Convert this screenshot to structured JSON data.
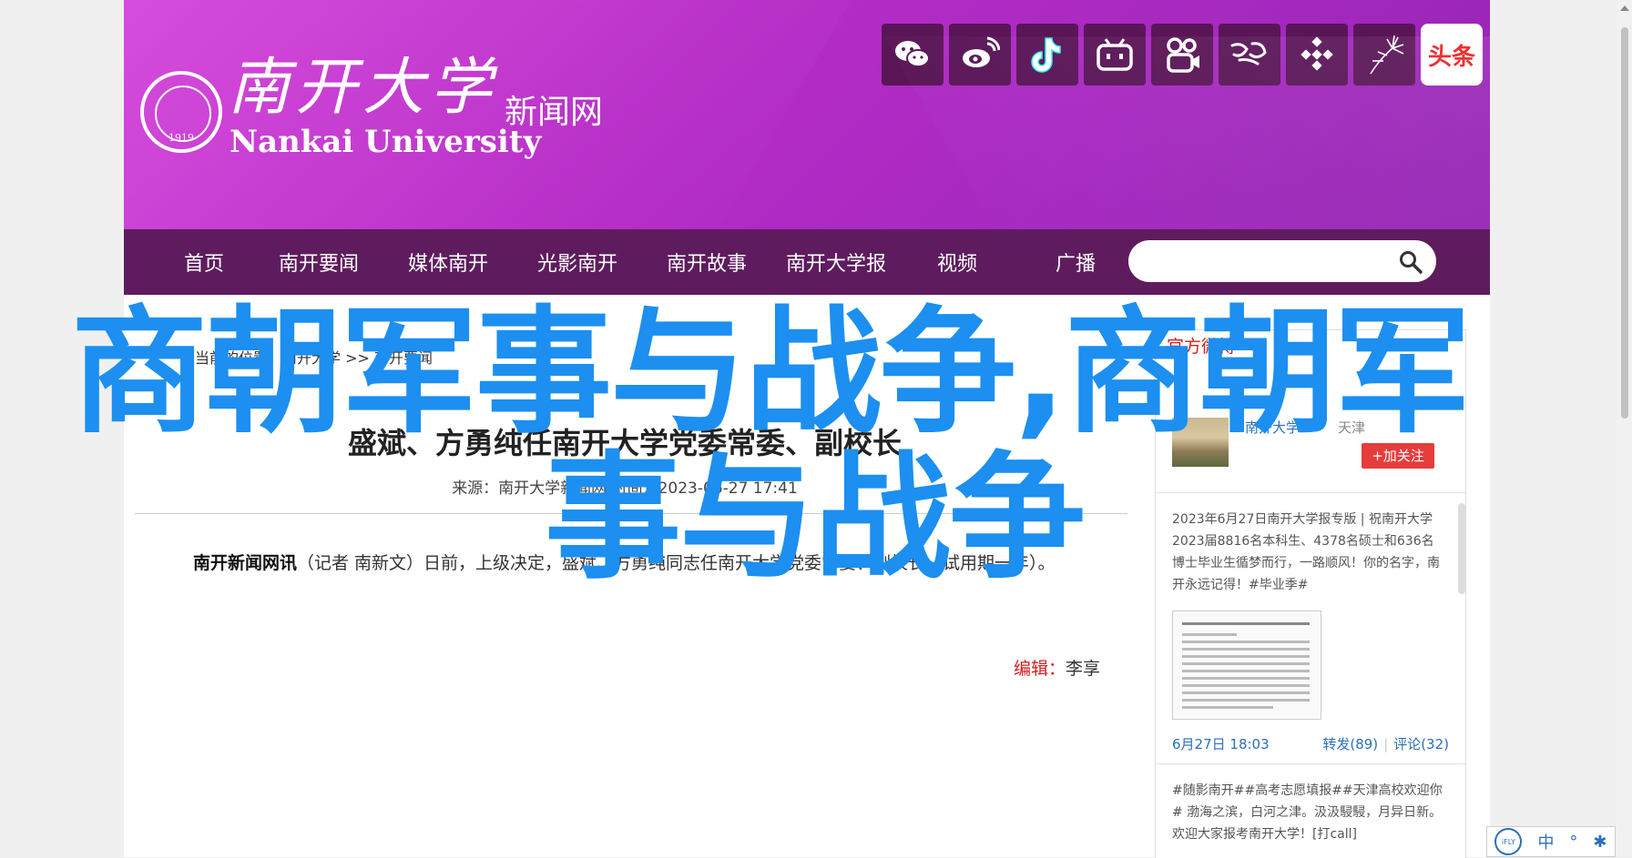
{
  "header": {
    "logo_cn": "南开大学",
    "logo_en": "Nankai University",
    "logo_sub": "新闻网",
    "seal_year": "1919",
    "social_icons": [
      "wechat-icon",
      "weibo-icon",
      "douyin-icon",
      "bilibili-icon",
      "kuaishou-icon",
      "xuexi-icon",
      "qingting-icon",
      "dandelion-icon",
      "toutiao-icon"
    ],
    "toutiao_label": "头条"
  },
  "nav": {
    "items": [
      "首页",
      "南开要闻",
      "媒体南开",
      "光影南开",
      "南开故事",
      "南开大学报",
      "视频",
      "广播"
    ],
    "search_placeholder": ""
  },
  "article": {
    "breadcrumb": "您当前的位置：南开大学 >> 南开要闻",
    "title": "盛斌、方勇纯任南开大学党委常委、副校长",
    "meta": "来源：南开大学新闻网    时间：2023-06-27 17:41",
    "lead_bold": "南开新闻网讯",
    "lead_text": "（记者 南新文）日前，上级决定，盛斌、方勇纯同志任南开大学党委常委、副校长（试用期一年）。",
    "editor_label": "编辑：",
    "editor_name": "李享"
  },
  "weibo_panel": {
    "header": "官方微博",
    "account_name": "南开大学",
    "account_location": "天津",
    "follow_label": "+加关注",
    "post1_text": "2023年6月27日南开大学报专版 | 祝南开大学2023届8816名本科生、4378名硕士和636名博士毕业生循梦而行，一路顺风！你的名字，南开永远记得！#毕业季#",
    "post1_date": "6月27日 18:03",
    "post1_repost": "转发(89)",
    "post1_comment": "评论(32)",
    "post2_text": "#随影南开##高考志愿填报##天津高校欢迎你# 渤海之滨，白河之津。汲汲駸駸，月异日新。欢迎大家报考南开大学！[打call]"
  },
  "overlay": {
    "line1": "商朝军事与战争,商朝军",
    "line2": "事与战争"
  },
  "ime": {
    "badge": "iFLY",
    "lang": "中"
  }
}
